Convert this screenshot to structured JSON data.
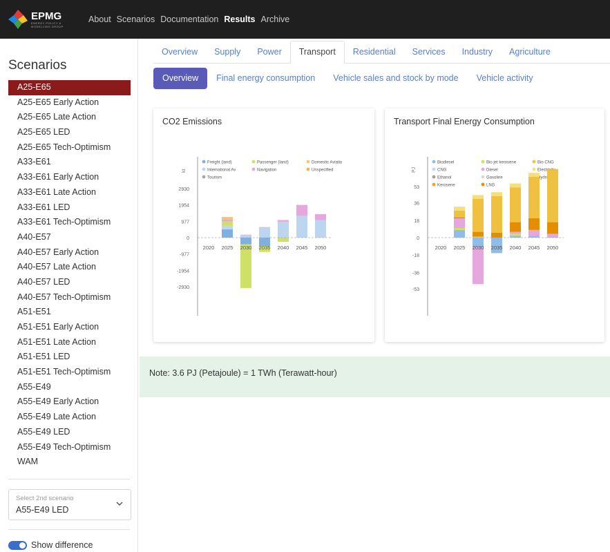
{
  "brand": {
    "name": "EPMG",
    "subtitle": "ENERGY POLICY & MODELLING GROUP"
  },
  "nav": {
    "links": [
      {
        "label": "About",
        "active": false
      },
      {
        "label": "Scenarios",
        "active": false
      },
      {
        "label": "Documentation",
        "active": false
      },
      {
        "label": "Results",
        "active": true
      },
      {
        "label": "Archive",
        "active": false
      }
    ]
  },
  "sidebar": {
    "title": "Scenarios",
    "selected": "A25-E65",
    "scenarios": [
      "A25-E65",
      "A25-E65 Early Action",
      "A25-E65 Late Action",
      "A25-E65 LED",
      "A25-E65 Tech-Optimism",
      "A33-E61",
      "A33-E61 Early Action",
      "A33-E61 Late Action",
      "A33-E61 LED",
      "A33-E61 Tech-Optimism",
      "A40-E57",
      "A40-E57 Early Action",
      "A40-E57 Late Action",
      "A40-E57 LED",
      "A40-E57 Tech-Optimism",
      "A51-E51",
      "A51-E51 Early Action",
      "A51-E51 Late Action",
      "A51-E51 LED",
      "A51-E51 Tech-Optimism",
      "A55-E49",
      "A55-E49 Early Action",
      "A55-E49 Late Action",
      "A55-E49 LED",
      "A55-E49 Tech-Optimism",
      "WAM"
    ],
    "second_scenario": {
      "placeholder": "Select 2nd scenario",
      "value": "A55-E49 LED"
    },
    "toggle": {
      "label": "Show difference",
      "on": true
    }
  },
  "tabs": {
    "main": [
      {
        "label": "Overview",
        "active": false
      },
      {
        "label": "Supply",
        "active": false
      },
      {
        "label": "Power",
        "active": false
      },
      {
        "label": "Transport",
        "active": true
      },
      {
        "label": "Residential",
        "active": false
      },
      {
        "label": "Services",
        "active": false
      },
      {
        "label": "Industry",
        "active": false
      },
      {
        "label": "Agriculture",
        "active": false
      }
    ],
    "sub": [
      {
        "label": "Overview",
        "active": true
      },
      {
        "label": "Final energy consumption",
        "active": false
      },
      {
        "label": "Vehicle sales and stock by mode",
        "active": false
      },
      {
        "label": "Vehicle activity",
        "active": false
      }
    ]
  },
  "note": "Note: 3.6 PJ (Petajoule) = 1 TWh (Terawatt-hour)",
  "chart_data": [
    {
      "type": "bar",
      "stacked": true,
      "title": "CO2 Emissions",
      "ylabel": "kt",
      "categories": [
        "2020",
        "2025",
        "2030",
        "2035",
        "2040",
        "2045",
        "2050"
      ],
      "yticks": [
        2930,
        1954,
        977,
        0,
        -977,
        -1954,
        -2930
      ],
      "ylim": [
        -3950,
        3900
      ],
      "legend_position": "top",
      "series": [
        {
          "name": "Freight (land)",
          "color": "#7fb0e0",
          "values": [
            0,
            500,
            -400,
            -500,
            0,
            0,
            0
          ]
        },
        {
          "name": "International Av",
          "color": "#bcd6ef",
          "values": [
            0,
            210,
            150,
            600,
            950,
            1300,
            1050
          ]
        },
        {
          "name": "Tourism",
          "color": "#a6a6a6",
          "values": [
            0,
            0,
            0,
            0,
            0,
            0,
            0
          ]
        },
        {
          "name": "Passenger (land)",
          "color": "#cfe066",
          "values": [
            0,
            260,
            -2600,
            -350,
            -250,
            0,
            0
          ]
        },
        {
          "name": "Navigation",
          "color": "#e6a6de",
          "values": [
            0,
            100,
            30,
            30,
            100,
            650,
            350
          ]
        },
        {
          "name": "Domestic Aviatio",
          "color": "#f6c86b",
          "values": [
            0,
            90,
            0,
            0,
            0,
            0,
            0
          ]
        },
        {
          "name": "Unspecified",
          "color": "#f1b541",
          "values": [
            0,
            60,
            0,
            0,
            0,
            0,
            0
          ]
        }
      ]
    },
    {
      "type": "bar",
      "stacked": true,
      "title": "Transport Final Energy Consumption",
      "ylabel": "PJ",
      "categories": [
        "2020",
        "2025",
        "2030",
        "2035",
        "2040",
        "2045",
        "2050"
      ],
      "yticks": [
        53,
        36,
        18,
        0,
        -18,
        -36,
        -53
      ],
      "ylim": [
        -75,
        74
      ],
      "legend_position": "top",
      "series": [
        {
          "name": "Biodiesel",
          "color": "#8fbde8",
          "values": [
            0,
            8,
            -10,
            -16,
            2,
            2,
            1
          ]
        },
        {
          "name": "CNG",
          "color": "#c1d8f0",
          "values": [
            0,
            0,
            0,
            0,
            0,
            0,
            0
          ]
        },
        {
          "name": "Ethanol",
          "color": "#9f9f9f",
          "values": [
            0,
            0,
            0,
            0,
            0,
            0,
            0
          ]
        },
        {
          "name": "Kerosene",
          "color": "#f0a030",
          "values": [
            0,
            0,
            0,
            0,
            0,
            0,
            0
          ]
        },
        {
          "name": "Bio jet kerosene",
          "color": "#cfe066",
          "values": [
            0,
            2,
            1,
            0,
            2,
            0,
            0
          ]
        },
        {
          "name": "Diesel",
          "color": "#e6a6de",
          "values": [
            0,
            10,
            -38,
            0,
            2,
            6,
            3
          ]
        },
        {
          "name": "Gasoline",
          "color": "#d9d9d9",
          "values": [
            0,
            0,
            0,
            0,
            0,
            0,
            0
          ]
        },
        {
          "name": "LNG",
          "color": "#e38e00",
          "values": [
            0,
            1,
            5,
            5,
            10,
            12,
            12
          ]
        },
        {
          "name": "Bio CNG",
          "color": "#f0c040",
          "values": [
            0,
            7,
            34,
            38,
            36,
            43,
            55
          ]
        },
        {
          "name": "Electricity",
          "color": "#f4e07a",
          "values": [
            0,
            4,
            4,
            4,
            4,
            4,
            0
          ]
        },
        {
          "name": "Hydrogen",
          "color": "#e8b43a",
          "values": [
            0,
            0,
            0,
            0,
            0,
            0,
            0
          ]
        }
      ]
    }
  ]
}
